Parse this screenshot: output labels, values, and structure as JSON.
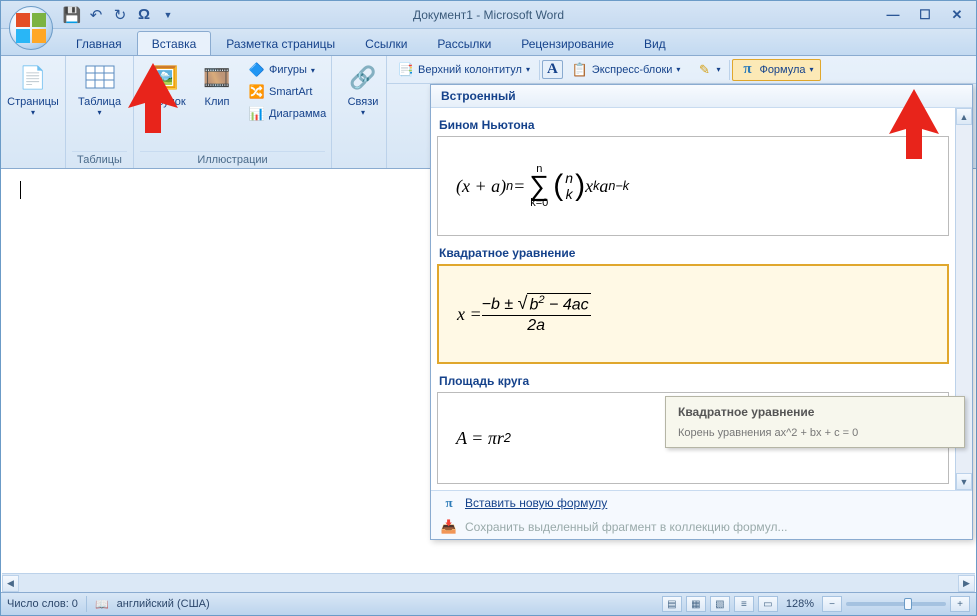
{
  "title": "Документ1 - Microsoft Word",
  "tabs": [
    "Главная",
    "Вставка",
    "Разметка страницы",
    "Ссылки",
    "Рассылки",
    "Рецензирование",
    "Вид"
  ],
  "active_tab": 1,
  "ribbon": {
    "pages": "Страницы",
    "table": "Таблица",
    "tables_group": "Таблицы",
    "picture": "Рисунок",
    "clip": "Клип",
    "shapes": "Фигуры",
    "smartart": "SmartArt",
    "chart": "Диаграмма",
    "illustrations_group": "Иллюстрации",
    "links": "Связи",
    "header": "Верхний колонтитул",
    "textbox_letter": "A",
    "quickparts": "Экспресс-блоки",
    "equation": "Формула"
  },
  "gallery": {
    "header": "Встроенный",
    "items": [
      {
        "title": "Бином Ньютона"
      },
      {
        "title": "Квадратное уравнение"
      },
      {
        "title": "Площадь круга"
      }
    ],
    "insert_new": "Вставить новую формулу",
    "save_selection": "Сохранить выделенный фрагмент в коллекцию формул..."
  },
  "tooltip": {
    "title": "Квадратное уравнение",
    "body": "Корень уравнения ax^2 + bx + c = 0"
  },
  "status": {
    "words": "Число слов: 0",
    "lang": "английский (США)",
    "zoom": "128%"
  }
}
